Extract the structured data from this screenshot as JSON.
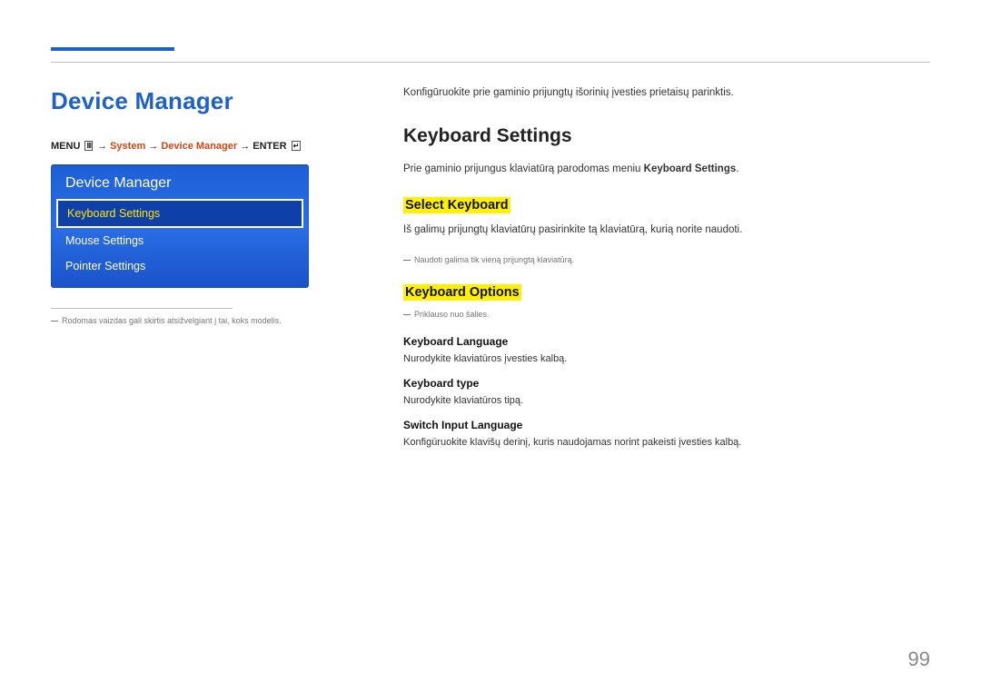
{
  "page_number": "99",
  "left": {
    "title": "Device Manager",
    "breadcrumb": {
      "menu_word": "MENU",
      "menu_icon": "Ⅲ",
      "arrow": "→",
      "system": "System",
      "devmgr": "Device Manager",
      "enter_word": "ENTER",
      "enter_icon": "↵"
    },
    "menubox": {
      "title": "Device Manager",
      "items": [
        {
          "label": "Keyboard Settings",
          "selected": true
        },
        {
          "label": "Mouse Settings",
          "selected": false
        },
        {
          "label": "Pointer Settings",
          "selected": false
        }
      ]
    },
    "note": "Rodomas vaizdas gali skirtis atsižvelgiant į tai, koks modelis."
  },
  "right": {
    "lead": "Konfigūruokite prie gaminio prijungtų išorinių įvesties prietaisų parinktis.",
    "h2": "Keyboard Settings",
    "p1_a": "Prie gaminio prijungus klaviatūrą parodomas meniu ",
    "p1_b_bold": "Keyboard Settings",
    "p1_c": ".",
    "select_keyboard": {
      "heading": "Select Keyboard",
      "p": "Iš galimų prijungtų klaviatūrų pasirinkite tą klaviatūrą, kurią norite naudoti.",
      "note": "Naudoti galima tik vieną prijungtą klaviatūrą."
    },
    "keyboard_options": {
      "heading": "Keyboard Options",
      "note": "Priklauso nuo šalies.",
      "lang_h": "Keyboard Language",
      "lang_p": "Nurodykite klaviatūros įvesties kalbą.",
      "type_h": "Keyboard type",
      "type_p": "Nurodykite klaviatūros tipą.",
      "switch_h": "Switch Input Language",
      "switch_p": "Konfigūruokite klavišų derinį, kuris naudojamas norint pakeisti įvesties kalbą."
    }
  }
}
